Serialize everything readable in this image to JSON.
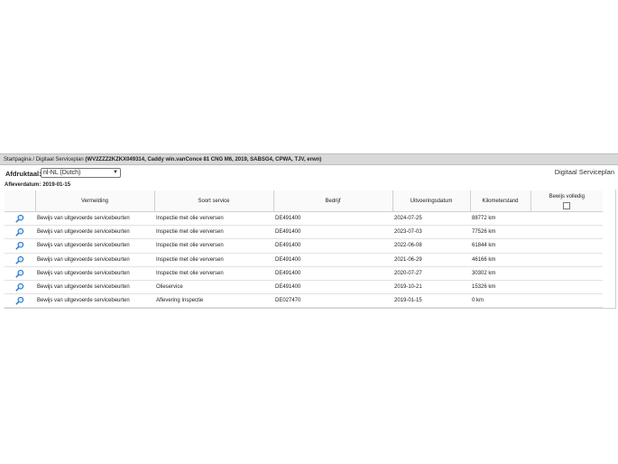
{
  "breadcrumb": {
    "home": "Startpagina",
    "separator": " / ",
    "section": "Digitaal Serviceplan",
    "vehicle": "(WV2ZZZ2KZKX049314, Caddy win.vanConce 81 CNG M6, 2019, SABSG4, CPWA, TJV, erwn)"
  },
  "toolbar": {
    "print_label": "Afdruktaal:",
    "print_language": "nl-NL (Dutch)",
    "module_title": "Digitaal Serviceplan"
  },
  "delivery": {
    "label": "Afleverdatum:",
    "date": "2019-01-15"
  },
  "table": {
    "headers": {
      "vermelding": "Vermelding",
      "soort": "Soort service",
      "bedrijf": "Bedrijf",
      "datum": "Uitvoeringsdatum",
      "km": "Kilometerstand",
      "compleet": "Bewijs volledig"
    },
    "rows": [
      {
        "vermelding": "Bewijs van uitgevoerde servicebeurten",
        "soort": "Inspectie met olie verversen",
        "bedrijf": "DE491400",
        "datum": "2024-07-25",
        "km": "88772 km"
      },
      {
        "vermelding": "Bewijs van uitgevoerde servicebeurten",
        "soort": "Inspectie met olie verversen",
        "bedrijf": "DE491400",
        "datum": "2023-07-03",
        "km": "77526 km"
      },
      {
        "vermelding": "Bewijs van uitgevoerde servicebeurten",
        "soort": "Inspectie met olie verversen",
        "bedrijf": "DE491400",
        "datum": "2022-06-08",
        "km": "61844 km"
      },
      {
        "vermelding": "Bewijs van uitgevoerde servicebeurten",
        "soort": "Inspectie met olie verversen",
        "bedrijf": "DE491400",
        "datum": "2021-06-29",
        "km": "46166 km"
      },
      {
        "vermelding": "Bewijs van uitgevoerde servicebeurten",
        "soort": "Inspectie met olie verversen",
        "bedrijf": "DE491400",
        "datum": "2020-07-27",
        "km": "30302 km"
      },
      {
        "vermelding": "Bewijs van uitgevoerde servicebeurten",
        "soort": "Olieservice",
        "bedrijf": "DE491400",
        "datum": "2019-10-21",
        "km": "15326 km"
      },
      {
        "vermelding": "Bewijs van uitgevoerde servicebeurten",
        "soort": "Aflevering Inspectie",
        "bedrijf": "DE027470",
        "datum": "2019-01-15",
        "km": "0 km"
      }
    ]
  },
  "icons": {
    "row_icon": "magnifier-icon",
    "select_chevron": "chevron-down-icon"
  },
  "colors": {
    "header_bar": "#d9d9d9",
    "magnifier": "#2c7ac9"
  }
}
